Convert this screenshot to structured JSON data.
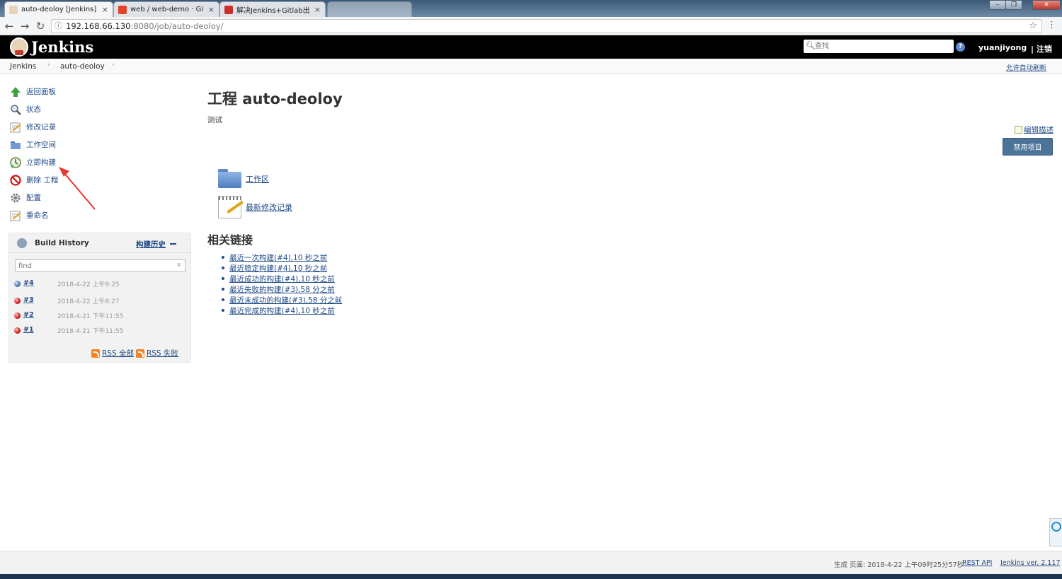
{
  "browser": {
    "tabs": [
      {
        "title": "auto-deoloy [Jenkins]",
        "active": true,
        "icon": "jenkins-favicon"
      },
      {
        "title": "web / web-demo · Git",
        "active": false,
        "icon": "gitlab-favicon"
      },
      {
        "title": "解决Jenkins+Gitlab出",
        "active": false,
        "icon": "csdn-favicon"
      },
      {
        "title": "",
        "active": false,
        "icon": "blank-favicon"
      }
    ],
    "url_host": "192.168.66.130",
    "url_path": ":8080/job/auto-deoloy/"
  },
  "header": {
    "brand": "Jenkins",
    "search_placeholder": "查找",
    "user": "yuanjiyong",
    "logout": "| 注销"
  },
  "breadcrumb": {
    "items": [
      "Jenkins",
      "auto-deoloy"
    ],
    "autorefresh": "允许自动刷新"
  },
  "tasks": [
    {
      "label": "返回面板",
      "icon": "up-arrow-icon"
    },
    {
      "label": "状态",
      "icon": "magnifier-icon"
    },
    {
      "label": "修改记录",
      "icon": "notepad-icon"
    },
    {
      "label": "工作空间",
      "icon": "folder-icon"
    },
    {
      "label": "立即构建",
      "icon": "build-clock-icon"
    },
    {
      "label": "删除 工程",
      "icon": "no-entry-icon"
    },
    {
      "label": "配置",
      "icon": "gear-icon"
    },
    {
      "label": "重命名",
      "icon": "notepad-icon"
    }
  ],
  "build_history": {
    "title": "Build History",
    "trend": "构建历史",
    "find_placeholder": "find",
    "builds": [
      {
        "number": "#4",
        "time": "2018-4-22 上午9:25",
        "status": "blue"
      },
      {
        "number": "#3",
        "time": "2018-4-22 上午8:27",
        "status": "red"
      },
      {
        "number": "#2",
        "time": "2018-4-21 下午11:55",
        "status": "red"
      },
      {
        "number": "#1",
        "time": "2018-4-21 下午11:55",
        "status": "red"
      }
    ],
    "rss_all": "RSS 全部",
    "rss_failed": "RSS 失败"
  },
  "main": {
    "title": "工程 auto-deoloy",
    "description": "测试",
    "edit_description": "编辑描述",
    "disable_button": "禁用项目",
    "workspace_link": "工作区",
    "changes_link": "最新修改记录",
    "related_title": "相关链接",
    "related_links": [
      "最近一次构建(#4),10 秒之前",
      "最近稳定构建(#4),10 秒之前",
      "最近成功的构建(#4),10 秒之前",
      "最近失败的构建(#3),58 分之前",
      "最近未成功的构建(#3),58 分之前",
      "最近完成的构建(#4),10 秒之前"
    ]
  },
  "footer": {
    "generated": "生成 页面: 2018-4-22 上午09时25分57秒",
    "rest_api": "REST API",
    "version": "Jenkins ver. 2.117"
  },
  "colors": {
    "header_bg": "#000000",
    "link": "#204a87",
    "disable_button_bg": "#4b7397"
  }
}
